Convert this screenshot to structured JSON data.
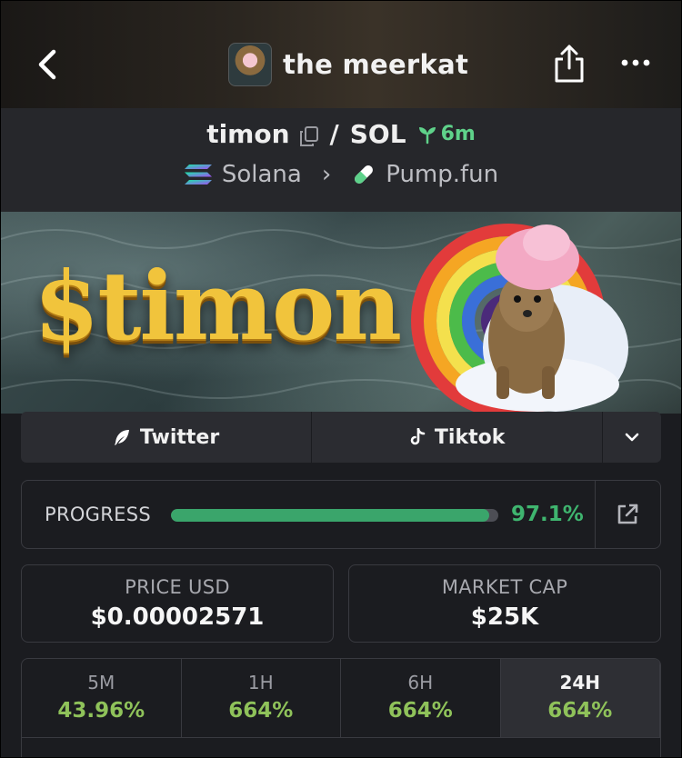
{
  "header": {
    "title": "the meerkat",
    "back_icon": "chevron-left-icon",
    "share_icon": "share-icon",
    "more_icon": "more-horizontal-icon"
  },
  "pair": {
    "base": "timon",
    "separator": "/",
    "quote": "SOL",
    "age": "6m",
    "chain": "Solana",
    "dex": "Pump.fun"
  },
  "banner": {
    "title": "$timon"
  },
  "social": {
    "twitter": "Twitter",
    "tiktok": "Tiktok"
  },
  "progress": {
    "label": "PROGRESS",
    "value_text": "97.1%",
    "value": 97.1
  },
  "stats": {
    "price_label": "PRICE USD",
    "price_value": "$0.00002571",
    "mcap_label": "MARKET CAP",
    "mcap_value": "$25K"
  },
  "timeframes": [
    {
      "label": "5M",
      "value": "43.96%",
      "active": false
    },
    {
      "label": "1H",
      "value": "664%",
      "active": false
    },
    {
      "label": "6H",
      "value": "664%",
      "active": false
    },
    {
      "label": "24H",
      "value": "664%",
      "active": true
    }
  ],
  "colors": {
    "accent_green": "#3fb56f",
    "positive_change": "#8fc25a",
    "age_green": "#5fd28a"
  }
}
